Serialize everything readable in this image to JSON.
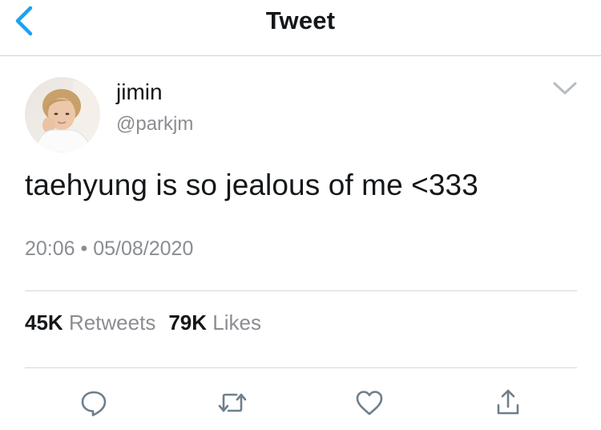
{
  "nav": {
    "title": "Tweet",
    "back_icon": "chevron-left-icon",
    "accent": "#1da1f2"
  },
  "tweet": {
    "author": {
      "name": "jimin",
      "handle": "@parkjm",
      "avatar": "profile-photo"
    },
    "menu_icon": "chevron-down-icon",
    "text": "taehyung is so jealous of me <333",
    "time": "20:06",
    "separator": "•",
    "date": "05/08/2020"
  },
  "stats": {
    "retweets_count": "45K",
    "retweets_label": "Retweets",
    "likes_count": "79K",
    "likes_label": "Likes"
  },
  "actions": [
    "reply-icon",
    "retweet-icon",
    "like-icon",
    "share-icon"
  ],
  "colors": {
    "text": "#14171a",
    "secondary": "#8a8d91",
    "icon": "#6e7f8b"
  }
}
